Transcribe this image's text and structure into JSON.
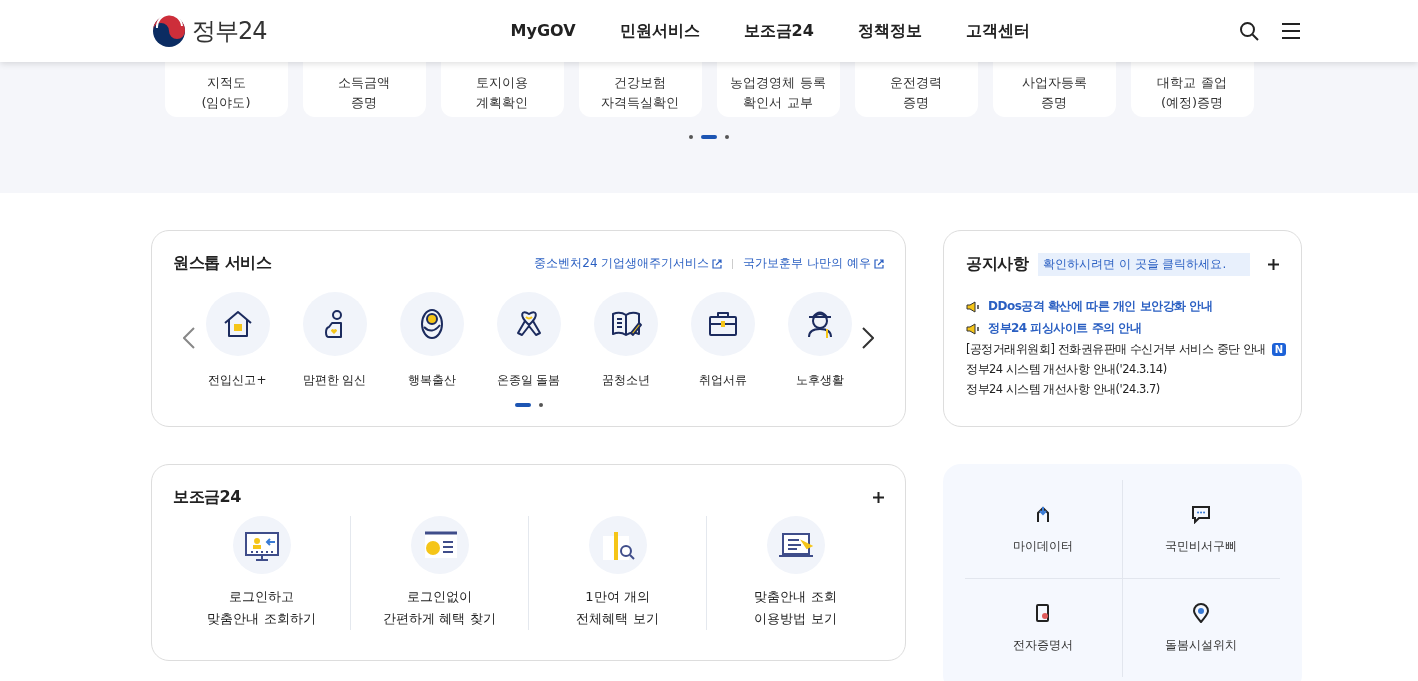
{
  "header": {
    "logo_text": "정부24",
    "nav": [
      "MyGOV",
      "민원서비스",
      "보조금24",
      "정책정보",
      "고객센터"
    ]
  },
  "quick_services": {
    "items": [
      {
        "line1": "지적도",
        "line2": "(임야도)"
      },
      {
        "line1": "소득금액",
        "line2": "증명"
      },
      {
        "line1": "토지이용",
        "line2": "계획확인"
      },
      {
        "line1": "건강보험",
        "line2": "자격득실확인"
      },
      {
        "line1": "농업경영체 등록",
        "line2": "확인서 교부"
      },
      {
        "line1": "운전경력",
        "line2": "증명"
      },
      {
        "line1": "사업자등록",
        "line2": "증명"
      },
      {
        "line1": "대학교 졸업",
        "line2": "(예정)증명"
      }
    ],
    "pages": [
      {
        "selected": false
      },
      {
        "selected": true
      },
      {
        "selected": false
      }
    ]
  },
  "onestop": {
    "title": "원스톱 서비스",
    "links": [
      "중소벤처24 기업생애주기서비스",
      "국가보훈부 나만의 예우"
    ],
    "items": [
      {
        "label": "전입신고+",
        "kind": "house"
      },
      {
        "label": "맘편한 임신",
        "kind": "pregnant"
      },
      {
        "label": "행복출산",
        "kind": "baby"
      },
      {
        "label": "온종일 돌봄",
        "kind": "ribbon"
      },
      {
        "label": "꿈청소년",
        "kind": "book"
      },
      {
        "label": "취업서류",
        "kind": "briefcase"
      },
      {
        "label": "노후생활",
        "kind": "elder"
      }
    ],
    "pages": [
      {
        "selected": true
      },
      {
        "selected": false
      }
    ]
  },
  "notices": {
    "title": "공지사항",
    "hint": "확인하시려면 이 곳을 클릭하세요.",
    "items": [
      {
        "text": "DDos공격 확산에 따른 개인 보안강화 안내",
        "kind": "alert",
        "new": false
      },
      {
        "text": "정부24 피싱사이트 주의 안내",
        "kind": "alert",
        "new": false
      },
      {
        "text": "[공정거래위원회] 전화권유판매 수신거부 서비스 중단 안내",
        "kind": "normal",
        "new": true,
        "badge": "N"
      },
      {
        "text": "정부24 시스템 개선사항 안내('24.3.14)",
        "kind": "normal",
        "new": false
      },
      {
        "text": "정부24 시스템 개선사항 안내('24.3.7)",
        "kind": "normal",
        "new": false
      }
    ]
  },
  "subsidy": {
    "title": "보조금24",
    "items": [
      {
        "line1": "로그인하고",
        "line2": "맞춤안내 조회하기",
        "kind": "login"
      },
      {
        "line1": "로그인없이",
        "line2": "간편하게 혜택 찾기",
        "kind": "question"
      },
      {
        "line1": "1만여 개의",
        "line2": "전체혜택 보기",
        "kind": "gift"
      },
      {
        "line1": "맞춤안내 조회",
        "line2": "이용방법 보기",
        "kind": "laptop"
      }
    ]
  },
  "shortcuts": [
    {
      "label": "마이데이터",
      "kind": "mydata"
    },
    {
      "label": "국민비서구삐",
      "kind": "chat"
    },
    {
      "label": "전자증명서",
      "kind": "phone"
    },
    {
      "label": "돌봄시설위치",
      "kind": "pin"
    }
  ]
}
